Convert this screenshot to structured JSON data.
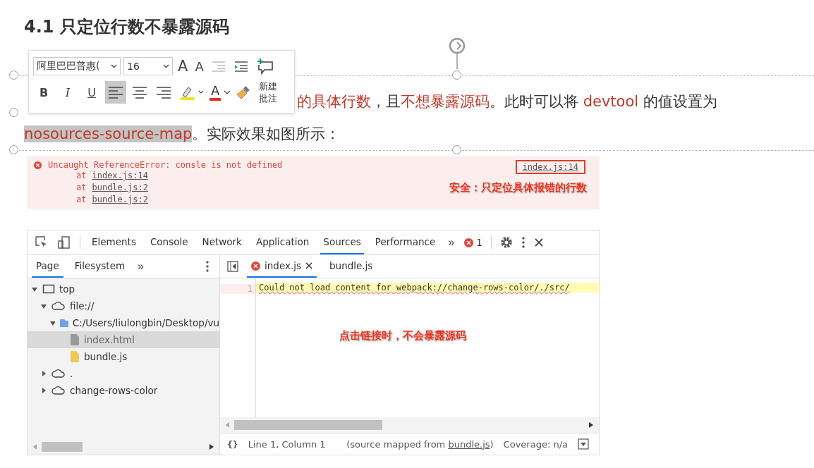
{
  "title": "4.1 只定位行数不暴露源码",
  "toolbar": {
    "font": "阿里巴巴普惠(",
    "size": "16",
    "grow": "A",
    "shrink": "A",
    "format_buttons": [
      {
        "kind": "bold",
        "label": "B",
        "selected": false
      },
      {
        "kind": "italic",
        "label": "I",
        "selected": false
      },
      {
        "kind": "underline",
        "label": "U",
        "selected": false
      },
      {
        "kind": "align-left",
        "selected": true
      },
      {
        "kind": "align-center",
        "selected": false
      },
      {
        "kind": "align-right",
        "selected": false
      }
    ],
    "font_color_label": "A",
    "new_comment": [
      "新建",
      "批注"
    ]
  },
  "paragraph": [
    [
      {
        "text": "的具体行数",
        "color": "#c0392b",
        "selected": false
      },
      {
        "text": "，且",
        "color": "#333333",
        "selected": false
      },
      {
        "text": "不想暴露源码",
        "color": "#c0392b",
        "selected": false
      },
      {
        "text": "。此时可以将 ",
        "color": "#333333",
        "selected": false
      },
      {
        "text": "devtool",
        "color": "#c0392b",
        "selected": false
      },
      {
        "text": " 的值设置为",
        "color": "#333333",
        "selected": false
      }
    ],
    [
      {
        "text": "nosources-source-map",
        "color": "#c0392b",
        "selected": true
      },
      {
        "text": "。实际效果如图所示：",
        "color": "#333333",
        "selected": false
      }
    ]
  ],
  "console": {
    "error": "Uncaught ReferenceError: consle is not defined",
    "stack": [
      {
        "prefix": "at",
        "link": "index.js:14"
      },
      {
        "prefix": "at",
        "link": "bundle.js:2"
      },
      {
        "prefix": "at",
        "link": "bundle.js:2"
      }
    ],
    "source_link": "index.js:14",
    "annotation": "安全：只定位具体报错的行数"
  },
  "devtools": {
    "tabs": [
      {
        "label": "Elements",
        "selected": false
      },
      {
        "label": "Console",
        "selected": false
      },
      {
        "label": "Network",
        "selected": false
      },
      {
        "label": "Application",
        "selected": false
      },
      {
        "label": "Sources",
        "selected": true
      },
      {
        "label": "Performance",
        "selected": false
      }
    ],
    "more": "»",
    "error_count": "1",
    "nav_tabs": [
      {
        "label": "Page",
        "selected": true
      },
      {
        "label": "Filesystem",
        "selected": false
      }
    ],
    "tree": [
      {
        "label": "top",
        "kind": "frame",
        "expanded": true,
        "selected": false,
        "children": [
          {
            "label": "file://",
            "kind": "cloud",
            "expanded": true,
            "selected": false,
            "children": [
              {
                "label": "C:/Users/liulongbin/Desktop/vu",
                "kind": "folder",
                "expanded": true,
                "selected": false,
                "children": [
                  {
                    "label": "index.html",
                    "kind": "file",
                    "selected": true
                  },
                  {
                    "label": "bundle.js",
                    "kind": "script",
                    "selected": false
                  }
                ]
              }
            ]
          },
          {
            "label": ".",
            "kind": "cloud",
            "expanded": false,
            "selected": false
          },
          {
            "label": "change-rows-color",
            "kind": "cloud",
            "expanded": false,
            "selected": false
          }
        ]
      }
    ],
    "editor_tabs": [
      {
        "label": "index.js",
        "error": true,
        "selected": true
      },
      {
        "label": "bundle.js",
        "error": false,
        "selected": false
      }
    ],
    "line_number": "1",
    "line": "Could not load content for webpack://change-rows-color/./src/",
    "annotation": "点击链接时，不会暴露源码",
    "status": {
      "braces": "{}",
      "position": "Line 1, Column 1",
      "mapped_prefix": "(source mapped from ",
      "mapped_link": "bundle.js",
      "mapped_suffix": ")",
      "coverage": "Coverage: n/a"
    }
  }
}
